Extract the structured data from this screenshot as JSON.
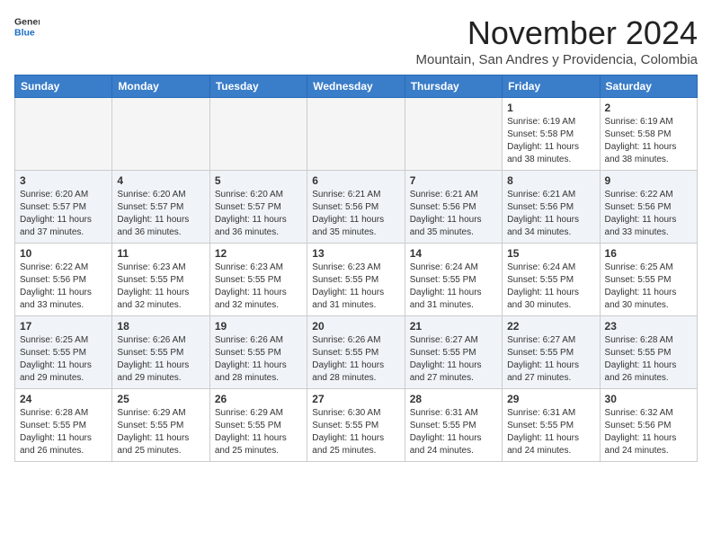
{
  "header": {
    "logo_line1": "General",
    "logo_line2": "Blue",
    "month": "November 2024",
    "location": "Mountain, San Andres y Providencia, Colombia"
  },
  "weekdays": [
    "Sunday",
    "Monday",
    "Tuesday",
    "Wednesday",
    "Thursday",
    "Friday",
    "Saturday"
  ],
  "weeks": [
    [
      {
        "day": "",
        "info": ""
      },
      {
        "day": "",
        "info": ""
      },
      {
        "day": "",
        "info": ""
      },
      {
        "day": "",
        "info": ""
      },
      {
        "day": "",
        "info": ""
      },
      {
        "day": "1",
        "info": "Sunrise: 6:19 AM\nSunset: 5:58 PM\nDaylight: 11 hours and 38 minutes."
      },
      {
        "day": "2",
        "info": "Sunrise: 6:19 AM\nSunset: 5:58 PM\nDaylight: 11 hours and 38 minutes."
      }
    ],
    [
      {
        "day": "3",
        "info": "Sunrise: 6:20 AM\nSunset: 5:57 PM\nDaylight: 11 hours and 37 minutes."
      },
      {
        "day": "4",
        "info": "Sunrise: 6:20 AM\nSunset: 5:57 PM\nDaylight: 11 hours and 36 minutes."
      },
      {
        "day": "5",
        "info": "Sunrise: 6:20 AM\nSunset: 5:57 PM\nDaylight: 11 hours and 36 minutes."
      },
      {
        "day": "6",
        "info": "Sunrise: 6:21 AM\nSunset: 5:56 PM\nDaylight: 11 hours and 35 minutes."
      },
      {
        "day": "7",
        "info": "Sunrise: 6:21 AM\nSunset: 5:56 PM\nDaylight: 11 hours and 35 minutes."
      },
      {
        "day": "8",
        "info": "Sunrise: 6:21 AM\nSunset: 5:56 PM\nDaylight: 11 hours and 34 minutes."
      },
      {
        "day": "9",
        "info": "Sunrise: 6:22 AM\nSunset: 5:56 PM\nDaylight: 11 hours and 33 minutes."
      }
    ],
    [
      {
        "day": "10",
        "info": "Sunrise: 6:22 AM\nSunset: 5:56 PM\nDaylight: 11 hours and 33 minutes."
      },
      {
        "day": "11",
        "info": "Sunrise: 6:23 AM\nSunset: 5:55 PM\nDaylight: 11 hours and 32 minutes."
      },
      {
        "day": "12",
        "info": "Sunrise: 6:23 AM\nSunset: 5:55 PM\nDaylight: 11 hours and 32 minutes."
      },
      {
        "day": "13",
        "info": "Sunrise: 6:23 AM\nSunset: 5:55 PM\nDaylight: 11 hours and 31 minutes."
      },
      {
        "day": "14",
        "info": "Sunrise: 6:24 AM\nSunset: 5:55 PM\nDaylight: 11 hours and 31 minutes."
      },
      {
        "day": "15",
        "info": "Sunrise: 6:24 AM\nSunset: 5:55 PM\nDaylight: 11 hours and 30 minutes."
      },
      {
        "day": "16",
        "info": "Sunrise: 6:25 AM\nSunset: 5:55 PM\nDaylight: 11 hours and 30 minutes."
      }
    ],
    [
      {
        "day": "17",
        "info": "Sunrise: 6:25 AM\nSunset: 5:55 PM\nDaylight: 11 hours and 29 minutes."
      },
      {
        "day": "18",
        "info": "Sunrise: 6:26 AM\nSunset: 5:55 PM\nDaylight: 11 hours and 29 minutes."
      },
      {
        "day": "19",
        "info": "Sunrise: 6:26 AM\nSunset: 5:55 PM\nDaylight: 11 hours and 28 minutes."
      },
      {
        "day": "20",
        "info": "Sunrise: 6:26 AM\nSunset: 5:55 PM\nDaylight: 11 hours and 28 minutes."
      },
      {
        "day": "21",
        "info": "Sunrise: 6:27 AM\nSunset: 5:55 PM\nDaylight: 11 hours and 27 minutes."
      },
      {
        "day": "22",
        "info": "Sunrise: 6:27 AM\nSunset: 5:55 PM\nDaylight: 11 hours and 27 minutes."
      },
      {
        "day": "23",
        "info": "Sunrise: 6:28 AM\nSunset: 5:55 PM\nDaylight: 11 hours and 26 minutes."
      }
    ],
    [
      {
        "day": "24",
        "info": "Sunrise: 6:28 AM\nSunset: 5:55 PM\nDaylight: 11 hours and 26 minutes."
      },
      {
        "day": "25",
        "info": "Sunrise: 6:29 AM\nSunset: 5:55 PM\nDaylight: 11 hours and 25 minutes."
      },
      {
        "day": "26",
        "info": "Sunrise: 6:29 AM\nSunset: 5:55 PM\nDaylight: 11 hours and 25 minutes."
      },
      {
        "day": "27",
        "info": "Sunrise: 6:30 AM\nSunset: 5:55 PM\nDaylight: 11 hours and 25 minutes."
      },
      {
        "day": "28",
        "info": "Sunrise: 6:31 AM\nSunset: 5:55 PM\nDaylight: 11 hours and 24 minutes."
      },
      {
        "day": "29",
        "info": "Sunrise: 6:31 AM\nSunset: 5:55 PM\nDaylight: 11 hours and 24 minutes."
      },
      {
        "day": "30",
        "info": "Sunrise: 6:32 AM\nSunset: 5:56 PM\nDaylight: 11 hours and 24 minutes."
      }
    ]
  ]
}
